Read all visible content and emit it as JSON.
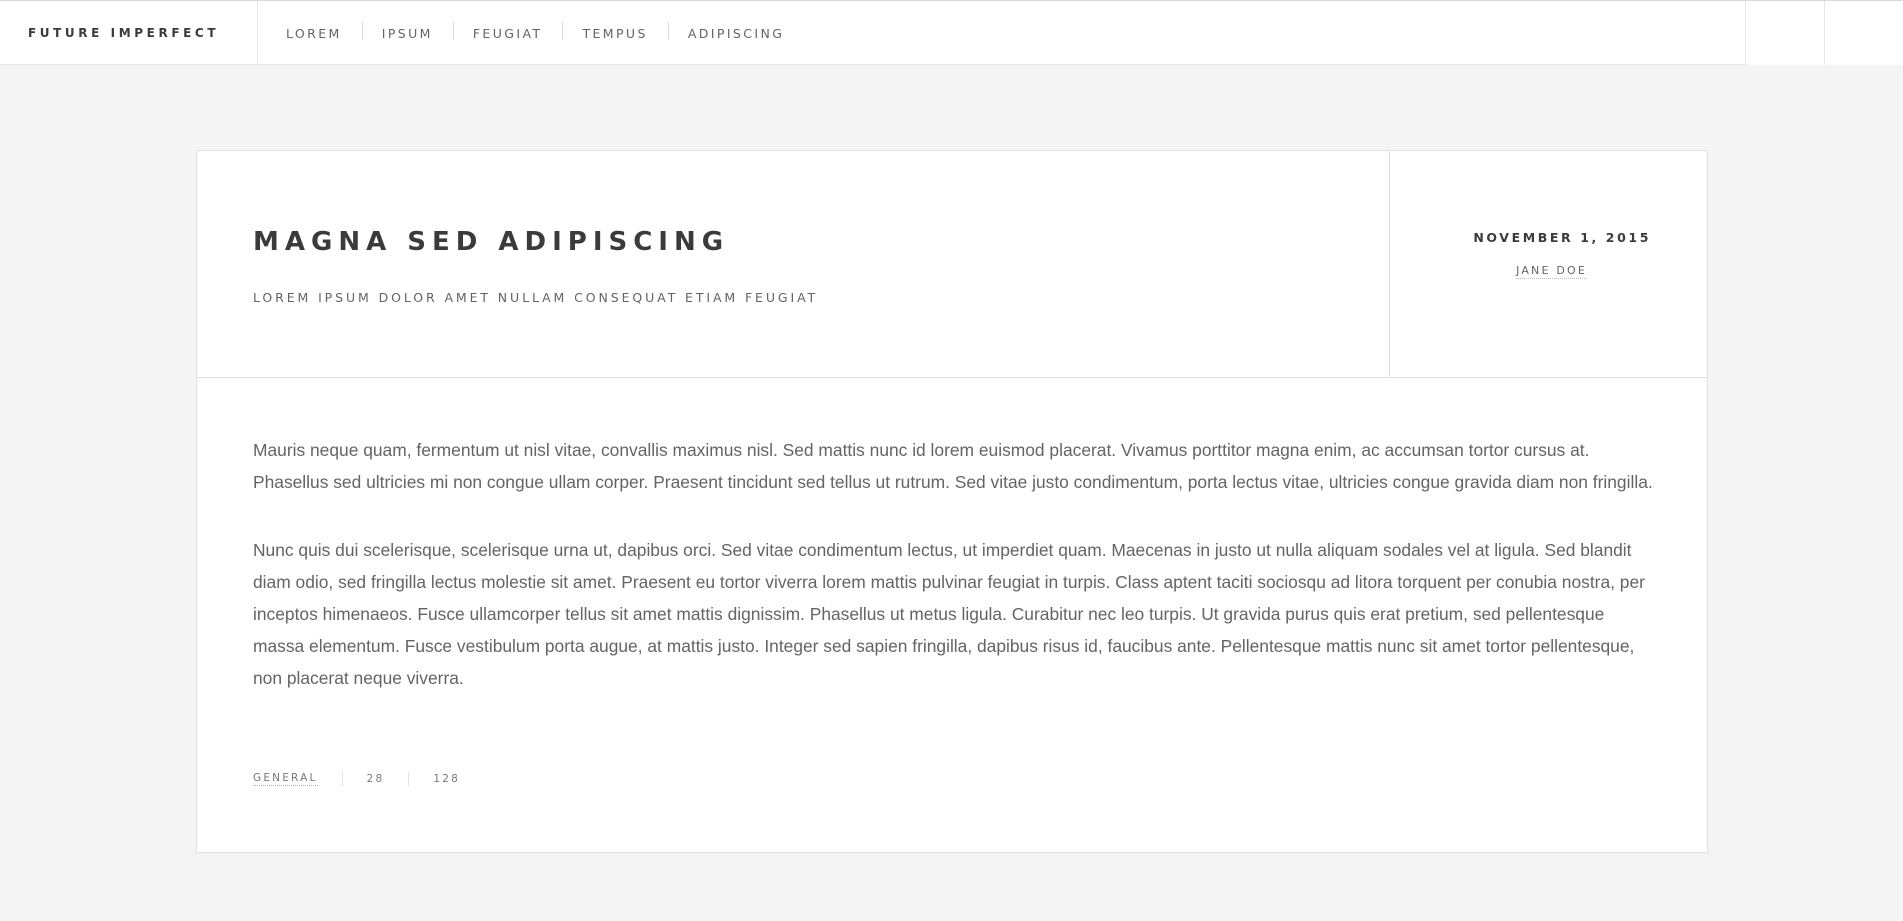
{
  "header": {
    "brand": "FUTURE IMPERFECT",
    "nav": [
      "LOREM",
      "IPSUM",
      "FEUGIAT",
      "TEMPUS",
      "ADIPISCING"
    ]
  },
  "post": {
    "title": "MAGNA SED ADIPISCING",
    "subtitle": "LOREM IPSUM DOLOR AMET NULLAM CONSEQUAT ETIAM FEUGIAT",
    "date": "NOVEMBER 1, 2015",
    "author": "JANE DOE",
    "paragraphs": [
      "Mauris neque quam, fermentum ut nisl vitae, convallis maximus nisl. Sed mattis nunc id lorem euismod placerat. Vivamus porttitor magna enim, ac accumsan tortor cursus at. Phasellus sed ultricies mi non congue ullam corper. Praesent tincidunt sed tellus ut rutrum. Sed vitae justo condimentum, porta lectus vitae, ultricies congue gravida diam non fringilla.",
      "Nunc quis dui scelerisque, scelerisque urna ut, dapibus orci. Sed vitae condimentum lectus, ut imperdiet quam. Maecenas in justo ut nulla aliquam sodales vel at ligula. Sed blandit diam odio, sed fringilla lectus molestie sit amet. Praesent eu tortor viverra lorem mattis pulvinar feugiat in turpis. Class aptent taciti sociosqu ad litora torquent per conubia nostra, per inceptos himenaeos. Fusce ullamcorper tellus sit amet mattis dignissim. Phasellus ut metus ligula. Curabitur nec leo turpis. Ut gravida purus quis erat pretium, sed pellentesque massa elementum. Fusce vestibulum porta augue, at mattis justo. Integer sed sapien fringilla, dapibus risus id, faucibus ante. Pellentesque mattis nunc sit amet tortor pellentesque, non placerat neque viverra."
    ],
    "footer": {
      "category": "GENERAL",
      "likes": "28",
      "comments": "128"
    }
  }
}
